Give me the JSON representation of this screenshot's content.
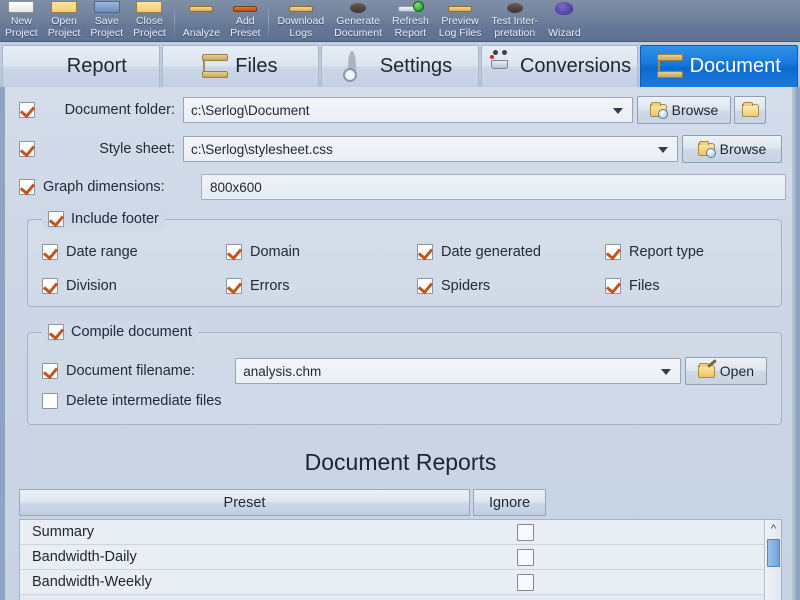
{
  "toolbar": {
    "items": [
      {
        "label": "New\nProject",
        "icon": "new-project-icon"
      },
      {
        "label": "Open\nProject",
        "icon": "open-project-icon"
      },
      {
        "label": "Save\nProject",
        "icon": "save-project-icon"
      },
      {
        "label": "Close\nProject",
        "icon": "close-project-icon"
      },
      {
        "label": "Analyze",
        "icon": "analyze-icon"
      },
      {
        "label": "Add\nPreset",
        "icon": "add-preset-icon"
      },
      {
        "label": "Download\nLogs",
        "icon": "download-logs-icon"
      },
      {
        "label": "Generate\nDocument",
        "icon": "generate-document-icon"
      },
      {
        "label": "Refresh\nReport",
        "icon": "refresh-report-icon"
      },
      {
        "label": "Preview\nLog Files",
        "icon": "preview-log-files-icon"
      },
      {
        "label": "Test Inter-\npretation",
        "icon": "test-interpretation-icon"
      },
      {
        "label": "Wizard",
        "icon": "wizard-icon"
      }
    ]
  },
  "tabs": [
    {
      "label": "Report",
      "icon": "pie-chart-icon",
      "active": false
    },
    {
      "label": "Files",
      "icon": "scroll-icon",
      "active": false
    },
    {
      "label": "Settings",
      "icon": "gear-magnifier-icon",
      "active": false
    },
    {
      "label": "Conversions",
      "icon": "shopping-cart-icon",
      "active": false
    },
    {
      "label": "Document",
      "icon": "scroll-icon",
      "active": true
    }
  ],
  "form": {
    "document_folder": {
      "label": "Document folder:",
      "checked": true,
      "value": "c:\\Serlog\\Document",
      "browse_label": "Browse"
    },
    "style_sheet": {
      "label": "Style sheet:",
      "checked": true,
      "value": "c:\\Serlog\\stylesheet.css",
      "browse_label": "Browse"
    },
    "graph_dimensions": {
      "label": "Graph dimensions:",
      "checked": true,
      "value": "800x600"
    }
  },
  "include_footer": {
    "legend": "Include footer",
    "checked": true,
    "options": [
      {
        "label": "Date range",
        "checked": true
      },
      {
        "label": "Domain",
        "checked": true
      },
      {
        "label": "Date generated",
        "checked": true
      },
      {
        "label": "Report type",
        "checked": true
      },
      {
        "label": "Division",
        "checked": true
      },
      {
        "label": "Errors",
        "checked": true
      },
      {
        "label": "Spiders",
        "checked": true
      },
      {
        "label": "Files",
        "checked": true
      }
    ]
  },
  "compile_document": {
    "legend": "Compile document",
    "checked": true,
    "filename": {
      "label": "Document filename:",
      "checked": true,
      "value": "analysis.chm",
      "open_label": "Open"
    },
    "delete_intermediate": {
      "label": "Delete intermediate files",
      "checked": false
    }
  },
  "document_reports": {
    "title": "Document Reports",
    "columns": [
      "Preset",
      "Ignore"
    ],
    "rows": [
      {
        "preset": "Summary",
        "ignore": false
      },
      {
        "preset": "Bandwidth-Daily",
        "ignore": false
      },
      {
        "preset": "Bandwidth-Weekly",
        "ignore": false
      }
    ],
    "scroll_up_glyph": "^"
  },
  "colors": {
    "accent": "#1a7ade",
    "checkmark": "#c2541f",
    "panel_bg": "#ced8e7",
    "toolbar_bg": "#6f819b"
  }
}
